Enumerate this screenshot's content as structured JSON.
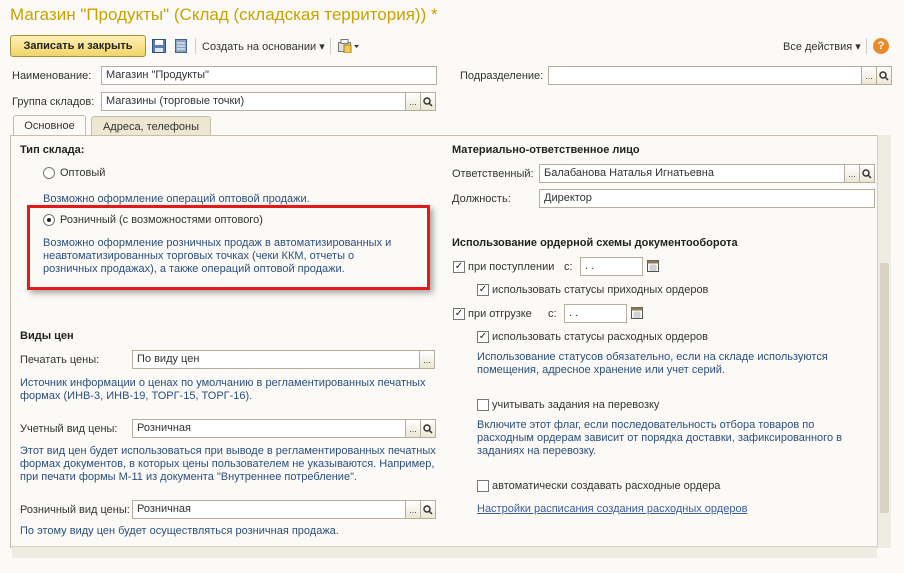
{
  "window": {
    "title": "Магазин \"Продукты\" (Склад (складская территория)) *"
  },
  "toolbar": {
    "save_close": "Записать и закрыть",
    "create_based": "Создать на основании",
    "all_actions": "Все действия",
    "help": "?"
  },
  "header": {
    "name_label": "Наименование:",
    "name_value": "Магазин \"Продукты\"",
    "group_label": "Группа складов:",
    "group_value": "Магазины (торговые точки)",
    "subdivision_label": "Подразделение:",
    "subdivision_value": ""
  },
  "tabs": [
    {
      "label": "Основное"
    },
    {
      "label": "Адреса, телефоны"
    }
  ],
  "left": {
    "type_title": "Тип склада:",
    "wholesale_label": "Оптовый",
    "wholesale_hint": "Возможно оформление операций оптовой продажи.",
    "retail_label": "Розничный (с возможностями оптового)",
    "retail_hint": "Возможно оформление розничных продаж в автоматизированных и неавтоматизированных торговых точках (чеки ККМ, отчеты о розничных продажах), а также операций оптовой продажи.",
    "prices_title": "Виды цен",
    "print_label": "Печатать цены:",
    "print_value": "По виду цен",
    "print_hint": "Источник информации о ценах по умолчанию в регламентированных печатных формах (ИНВ-3, ИНВ-19, ТОРГ-15, ТОРГ-16).",
    "account_label": "Учетный вид цены:",
    "account_value": "Розничная",
    "account_hint": "Этот вид цен будет использоваться при выводе в регламентированных печатных формах документов, в которых цены пользователем не указываются. Например, при печати формы М-11 из документа \"Внутреннее потребление\".",
    "retail_price_label": "Розничный вид цены:",
    "retail_price_value": "Розничная",
    "retail_price_hint": "По этому виду цен будет осуществляться розничная продажа."
  },
  "right": {
    "mol_title": "Материально-ответственное лицо",
    "responsible_label": "Ответственный:",
    "responsible_value": "Балабанова Наталья Игнатьевна",
    "position_label": "Должность:",
    "position_value": "Директор",
    "order_title": "Использование ордерной схемы документооборота",
    "on_receipt_label": "при поступлении",
    "from_label": "с:",
    "date_placeholder": " .  .",
    "use_in_status_label": "использовать статусы приходных ордеров",
    "on_shipment_label": "при отгрузке",
    "use_out_status_label": "использовать статусы расходных ордеров",
    "status_hint": "Использование статусов обязательно, если на складе используются помещения, адресное хранение или учет серий.",
    "transfer_label": "учитывать задания на перевозку",
    "transfer_hint": "Включите этот флаг, если последовательность отбора товаров по расходным ордерам зависит от порядка доставки, зафиксированного в заданиях на перевозку.",
    "auto_label": "автоматически создавать расходные ордера",
    "schedule_link": "Настройки расписания создания расходных ордеров"
  }
}
